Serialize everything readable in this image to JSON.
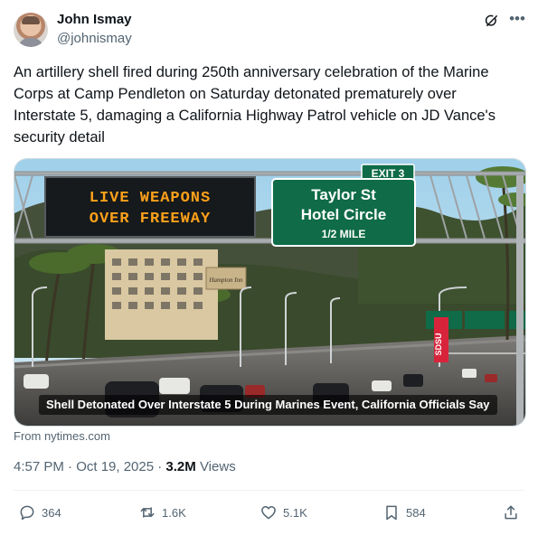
{
  "author": {
    "name": "John Ismay",
    "handle": "@johnismay"
  },
  "tweet": {
    "text": "An artillery shell fired during 250th anniversary celebration of the Marine Corps at Camp Pendleton on Saturday detonated prematurely over Interstate 5, damaging a California Highway Patrol vehicle on JD Vance's security detail"
  },
  "media": {
    "led_sign_line1": "LIVE WEAPONS",
    "led_sign_line2": "OVER FREEWAY",
    "exit_tab": "EXIT 3",
    "green_sign_line1": "Taylor St",
    "green_sign_line2": "Hotel Circle",
    "green_sign_line3": "1/2 MILE",
    "hotel_sign": "Hampton Inn",
    "side_sign": "SDSU",
    "caption": "Shell Detonated Over Interstate 5 During Marines Event, California Officials Say"
  },
  "source": "From nytimes.com",
  "meta": {
    "datetime": "4:57 PM · Oct 19, 2025 · ",
    "views_count": "3.2M",
    "views_label": " Views"
  },
  "actions": {
    "replies": "364",
    "reposts": "1.6K",
    "likes": "5.1K",
    "bookmarks": "584"
  },
  "colors": {
    "text": "#0f1419",
    "secondary": "#536471",
    "highway_sign_green": "#0f6b48",
    "led_amber": "#ffa11a"
  },
  "icons": [
    "grok-icon",
    "more-icon",
    "reply-icon",
    "repost-icon",
    "like-icon",
    "bookmark-icon",
    "share-icon"
  ]
}
